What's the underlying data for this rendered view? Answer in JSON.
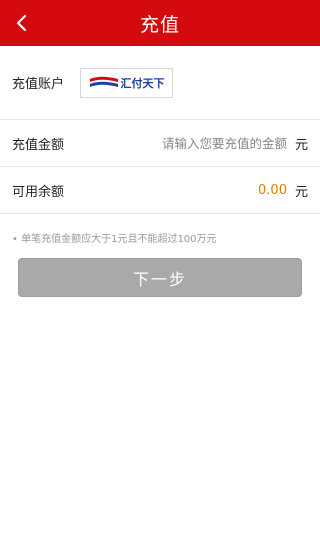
{
  "header": {
    "title": "充值",
    "back_icon": "chevron-left-icon"
  },
  "account": {
    "label": "充值账户",
    "logo_text": "汇付天下"
  },
  "amount": {
    "label": "充值金额",
    "placeholder": "请输入您要充值的金额",
    "value": "",
    "unit": "元"
  },
  "balance": {
    "label": "可用余额",
    "value": "0.00",
    "unit": "元"
  },
  "note": "• 单笔充值金额应大于1元且不能超过100万元",
  "next_button": "下一步",
  "colors": {
    "header_bg": "#d40a0f",
    "balance_value": "#e07a00",
    "button_disabled": "#a9a9a9"
  }
}
